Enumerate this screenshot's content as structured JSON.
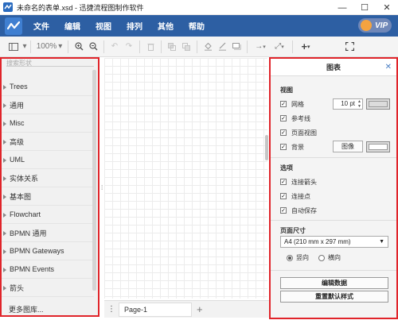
{
  "window": {
    "title": "未命名的表单.xsd - 迅捷流程图制作软件",
    "controls": [
      "—",
      "☐",
      "✕"
    ]
  },
  "menubar": {
    "items": [
      "文件",
      "编辑",
      "视图",
      "排列",
      "其他",
      "帮助"
    ],
    "vip_label": "VIP"
  },
  "toolbar": {
    "zoom_value": "100%"
  },
  "left_panel": {
    "search_placeholder": "搜索形状",
    "libraries": [
      "Trees",
      "通用",
      "Misc",
      "高级",
      "UML",
      "实体关系",
      "基本图",
      "Flowchart",
      "BPMN 通用",
      "BPMN Gateways",
      "BPMN Events",
      "箭头"
    ],
    "more_libraries": "更多图库..."
  },
  "bottom_bar": {
    "page_tab": "Page-1",
    "add_label": "+",
    "menu_label": "⋮"
  },
  "right_panel": {
    "title": "图表",
    "view_section": {
      "title": "视图",
      "grid_label": "网格",
      "grid_size": "10 pt",
      "guides_label": "参考线",
      "page_view_label": "页面视图",
      "background_label": "背景",
      "image_button": "图像"
    },
    "options_section": {
      "title": "选项",
      "connection_arrows_label": "连接箭头",
      "connection_points_label": "连接点",
      "autosave_label": "自动保存"
    },
    "page_size_section": {
      "title": "页面尺寸",
      "selected_size": "A4 (210 mm x 297 mm)",
      "portrait_label": "竖向",
      "landscape_label": "横向"
    },
    "edit_data_button": "编辑数据",
    "reset_style_button": "重置默认样式"
  }
}
